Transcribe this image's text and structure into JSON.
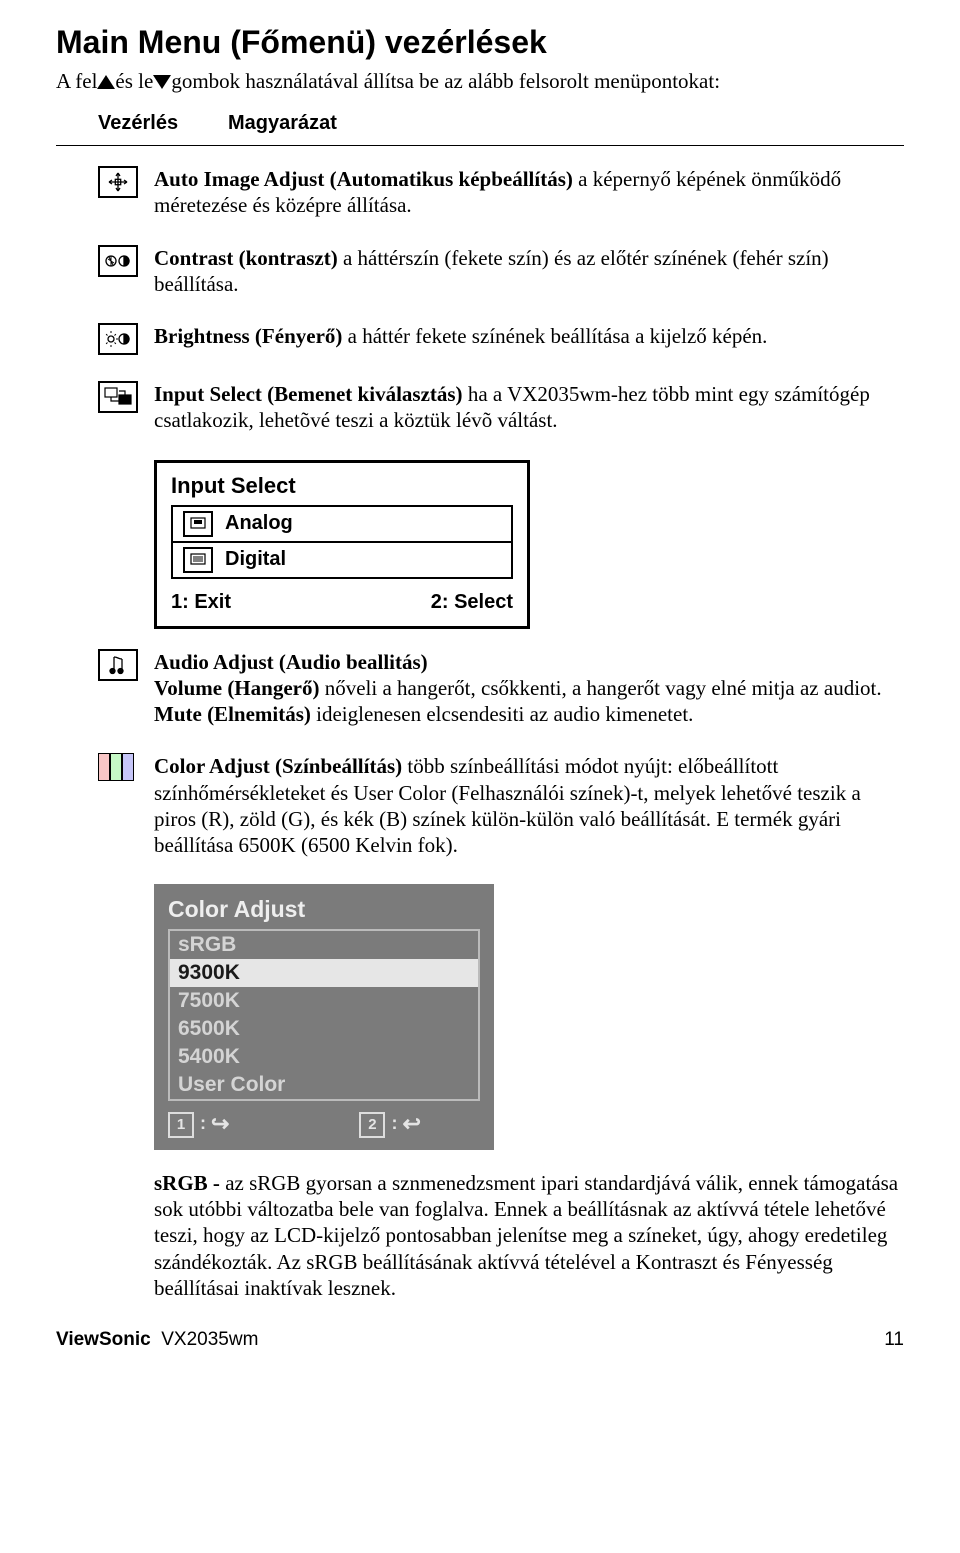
{
  "title": "Main Menu (Főmenü) vezérlések",
  "intro_p1": "A fel",
  "intro_p2": "és le",
  "intro_p3": "gombok használatával állítsa be az alább felsorolt menüpontokat:",
  "head_vez": "Vezérlés",
  "head_mag": "Magyarázat",
  "auto_image_b": "Auto Image Adjust (Automatikus képbeállítás)",
  "auto_image_t": " a képernyő képének önműködő méretezése és középre állítása.",
  "contrast_b": "Contrast (kontraszt)",
  "contrast_t": " a háttérszín (fekete szín) és az előtér színének (fehér szín) beállítása.",
  "brightness_b": "Brightness (Fényerő)",
  "brightness_t": " a háttér fekete színének beállítása a kijelző képén.",
  "input_b": "Input Select (Bemenet kiválasztás)",
  "input_t": " ha a VX2035wm-hez több mint egy számítógép csatlakozik, lehetõvé teszi a köztük lévõ váltást.",
  "osd_input_title": "Input Select",
  "osd_input_analog": "Analog",
  "osd_input_digital": "Digital",
  "osd_input_exit": "1: Exit",
  "osd_input_select": "2: Select",
  "audio_b": "Audio Adjust (Audio beallitás)",
  "audio_vol_b": "Volume (Hangerő)",
  "audio_vol_t": " nőveli a hangerőt, csőkkenti, a hangerőt vagy elné mitja az audiot.",
  "audio_mute_b": "Mute (Elnemitás)",
  "audio_mute_t": " ideiglenesen elcsendesiti az audio kimenetet.",
  "color_b": "Color Adjust (Színbeállítás)",
  "color_t": " több színbeállítási módot nyújt: előbeállított színhőmérsékleteket és User Color (Felhasználói színek)-t, melyek lehetővé teszik a piros (R), zöld (G), és kék (B) színek külön-külön való beállítását. E termék gyári beállítása 6500K (6500 Kelvin fok).",
  "osd_color_title": "Color Adjust",
  "osd_color_items": [
    "sRGB",
    "9300K",
    "7500K",
    "6500K",
    "5400K",
    "User Color"
  ],
  "osd_color_sel_index": 1,
  "osd_color_key1": "1",
  "osd_color_key2": "2",
  "srgb_b": "sRGB - ",
  "srgb_t": "az sRGB gyorsan a sznmenedzsment ipari standardjává válik, ennek támogatása sok utóbbi változatba bele van foglalva. Ennek a beállításnak az aktívvá tétele lehetővé teszi, hogy az LCD-kijelző pontosabban jelenítse meg a színeket, úgy, ahogy eredetileg szándékozták. Az sRGB beállításának aktívvá tételével a Kontraszt és Fényesség beállításai inaktívak lesznek.",
  "footer_brand": "ViewSonic",
  "footer_model": "VX2035wm",
  "footer_page": "11"
}
